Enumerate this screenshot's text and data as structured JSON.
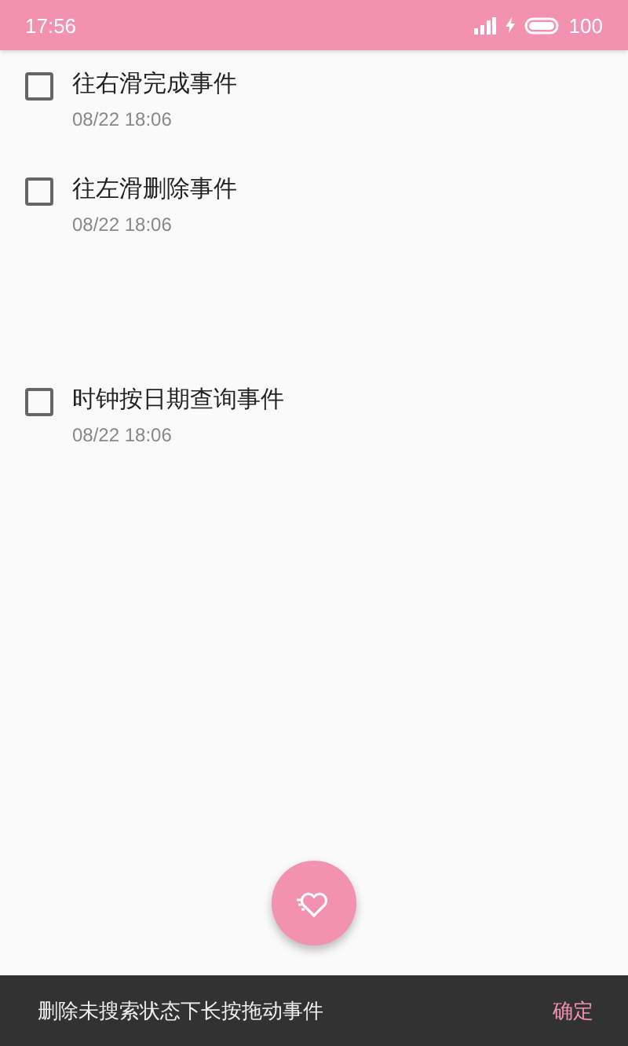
{
  "status_bar": {
    "time": "17:56",
    "battery": "100"
  },
  "events": [
    {
      "title": "往右滑完成事件",
      "time": "08/22 18:06",
      "checked": false
    },
    {
      "title": "往左滑删除事件",
      "time": "08/22 18:06",
      "checked": false
    },
    {
      "title": "时钟按日期查询事件",
      "time": "08/22 18:06",
      "checked": false
    }
  ],
  "snackbar": {
    "message": "删除未搜索状态下长按拖动事件",
    "action": "确定"
  }
}
